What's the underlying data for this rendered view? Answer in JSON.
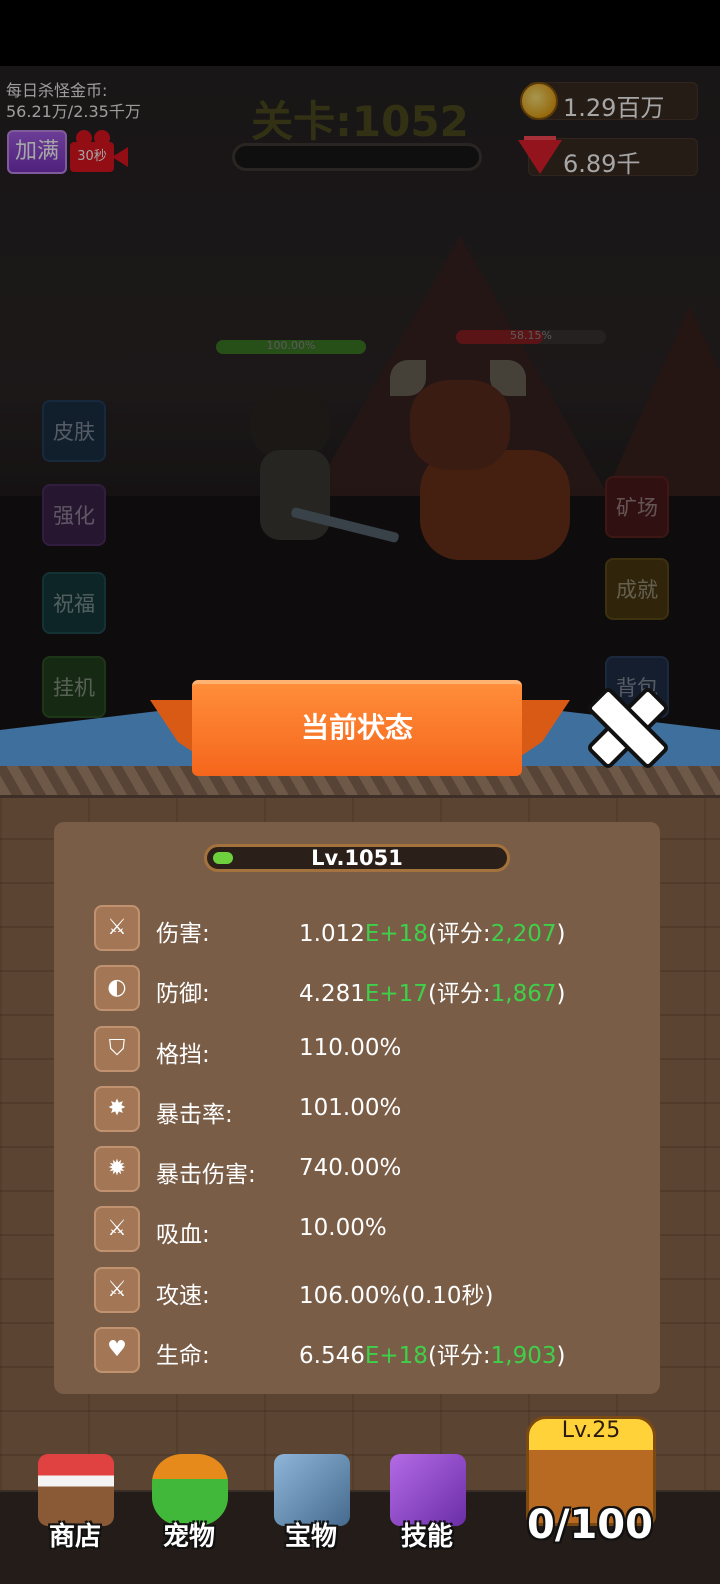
{
  "hud": {
    "daily_kill_gold_label": "每日杀怪金币:",
    "daily_kill_gold_value": "56.21万/2.35千万",
    "stage_label": "关卡:1052",
    "gold": "1.29百万",
    "gems": "6.89千",
    "fill_button": "加满",
    "video_timer": "30秒",
    "player_hp": "100.00%",
    "enemy_hp": "58.15%",
    "player_hp_fraction": 1.0,
    "enemy_hp_fraction": 0.5815
  },
  "side_left": [
    "皮肤",
    "强化",
    "祝福",
    "挂机"
  ],
  "side_right": [
    "矿场",
    "成就",
    "背包"
  ],
  "panel": {
    "title": "当前状态",
    "level": "Lv.1051",
    "level_fraction": 0.07,
    "stats": [
      {
        "icon": "sword-icon",
        "label": "伤害:",
        "base": "1.012",
        "exp": "E+18",
        "score_open": "(评分:",
        "score": "2,207",
        "score_close": ")"
      },
      {
        "icon": "shield-icon",
        "label": "防御:",
        "base": "4.281",
        "exp": "E+17",
        "score_open": "(评分:",
        "score": "1,867",
        "score_close": ")"
      },
      {
        "icon": "block-shield-icon",
        "label": "格挡:",
        "value": "110.00%"
      },
      {
        "icon": "crit-burst-icon",
        "label": "暴击率:",
        "value": "101.00%"
      },
      {
        "icon": "crit-damage-icon",
        "label": "暴击伤害:",
        "value": "740.00%"
      },
      {
        "icon": "lifesteal-icon",
        "label": "吸血:",
        "value": "10.00%"
      },
      {
        "icon": "attack-speed-icon",
        "label": "攻速:",
        "value": "106.00%(0.10秒)"
      },
      {
        "icon": "heart-plus-icon",
        "label": "生命:",
        "base": "6.546",
        "exp": "E+18",
        "score_open": "(评分:",
        "score": "1,903",
        "score_close": ")"
      }
    ]
  },
  "bottom_nav": {
    "shop": "商店",
    "pet": "宠物",
    "treasure": "宝物",
    "skill": "技能",
    "chest_level": "Lv.25",
    "chest_count": "0/100"
  },
  "colors": {
    "accent_orange": "#f5661b",
    "highlight_green": "#3fd04a",
    "panel_brown": "#7a5d47"
  }
}
